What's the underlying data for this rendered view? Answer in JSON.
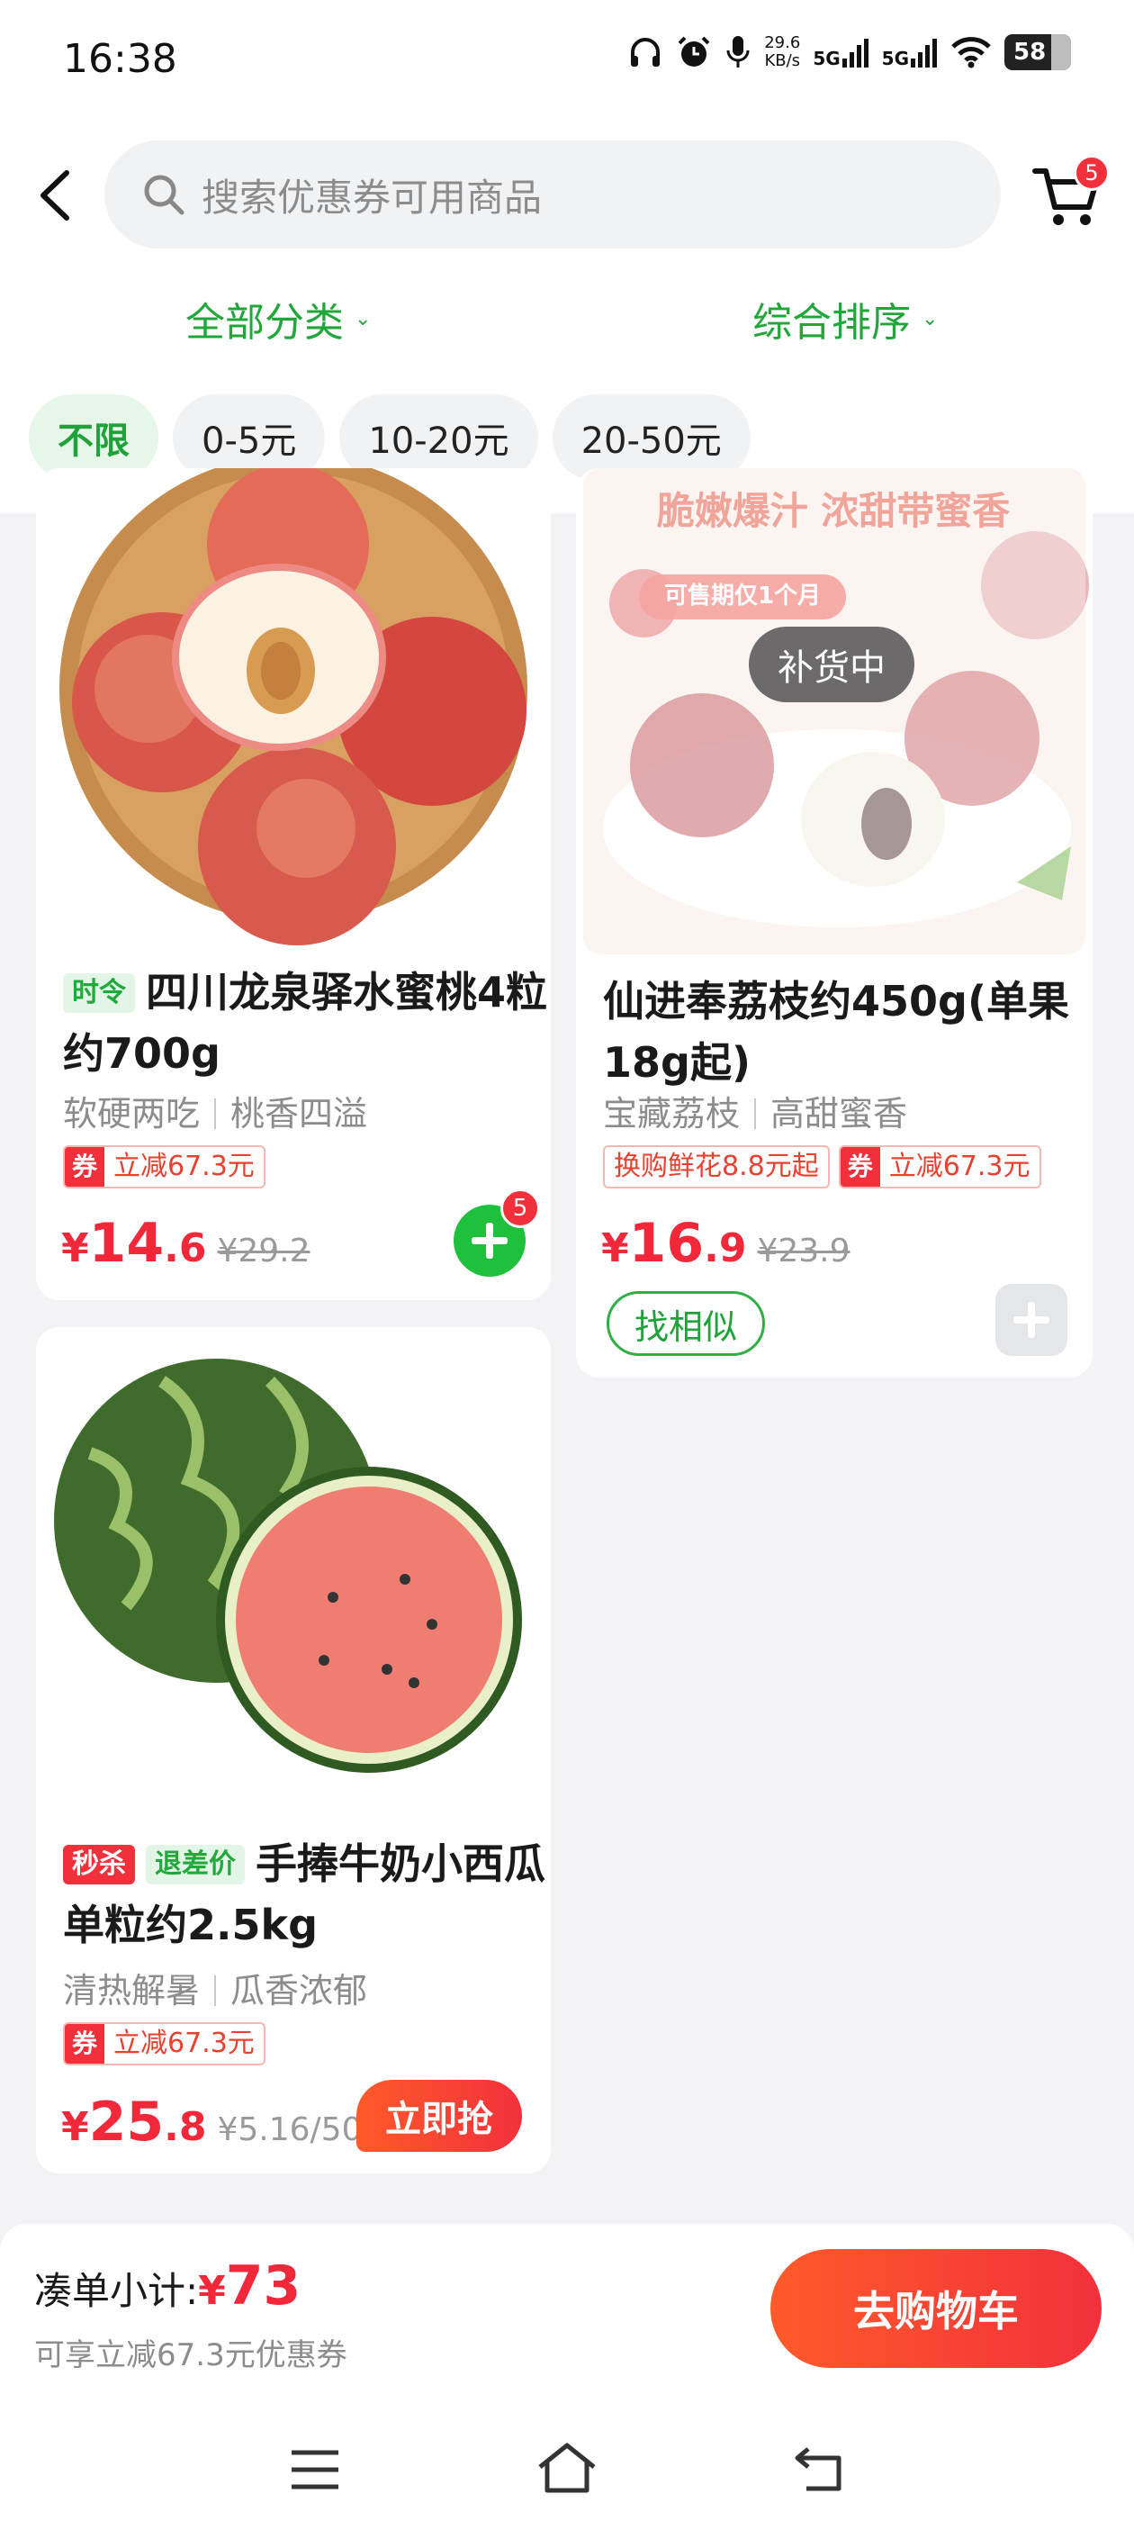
{
  "status_bar": {
    "time": "16:38",
    "speed": "29.6",
    "speed_unit": "KB/s",
    "net1": "5G",
    "net2": "5G",
    "battery": "58"
  },
  "search": {
    "placeholder": "搜索优惠券可用商品"
  },
  "cart": {
    "badge": "5"
  },
  "filters": {
    "category": "全部分类",
    "sort": "综合排序"
  },
  "price_chips": [
    "不限",
    "0-5元",
    "10-20元",
    "20-50元"
  ],
  "products": [
    {
      "tag": "时令",
      "title": "四川龙泉驿水蜜桃4粒约700g",
      "sub1": "软硬两吃",
      "sub2": "桃香四溢",
      "coupon_key": "券",
      "coupon_value": "立减67.3元",
      "price_cur": "¥",
      "price_int": "14",
      "price_dec": ".6",
      "price_old": "¥29.2",
      "cart_count": "5"
    },
    {
      "title": "仙进奉荔枝约450g(单果18g起)",
      "image_text_1": "脆嫩爆汁 浓甜带蜜香",
      "image_text_2": "可售期仅1个月",
      "restock": "补货中",
      "sub1": "宝藏荔枝",
      "sub2": "高甜蜜香",
      "promo": "换购鲜花8.8元起",
      "coupon_key": "券",
      "coupon_value": "立减67.3元",
      "price_cur": "¥",
      "price_int": "16",
      "price_dec": ".9",
      "price_old": "¥23.9",
      "similar": "找相似"
    },
    {
      "tag1": "秒杀",
      "tag2": "退差价",
      "title": "手捧牛奶小西瓜单粒约2.5kg",
      "sub1": "清热解暑",
      "sub2": "瓜香浓郁",
      "coupon_key": "券",
      "coupon_value": "立减67.3元",
      "price_cur": "¥",
      "price_int": "25",
      "price_dec": ".8",
      "price_unit": "¥5.16/500g",
      "action": "立即抢"
    }
  ],
  "bottom_bar": {
    "subtotal_label": "凑单小计:",
    "subtotal_cur": "¥",
    "subtotal_amount": "73",
    "note": "可享立减67.3元优惠券",
    "button": "去购物车"
  },
  "colors": {
    "accent_green": "#1fc13c",
    "price_red": "#f0283a",
    "badge_red": "#f2303b"
  }
}
